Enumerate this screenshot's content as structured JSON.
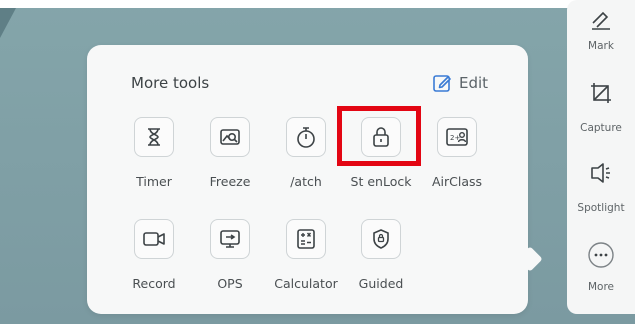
{
  "popup": {
    "title": "More tools",
    "edit_label": "Edit",
    "tools": [
      {
        "label": "Timer",
        "icon": "hourglass-icon"
      },
      {
        "label": "Freeze",
        "icon": "freeze-icon"
      },
      {
        "label": "/atch",
        "icon": "stopwatch-icon"
      },
      {
        "label": "St enLock",
        "icon": "lock-icon"
      },
      {
        "label": "AirClass",
        "icon": "airclass-icon"
      },
      {
        "label": "Record",
        "icon": "video-camera-icon"
      },
      {
        "label": "OPS",
        "icon": "monitor-icon"
      },
      {
        "label": "Calculator",
        "icon": "calculator-icon"
      },
      {
        "label": "Guided",
        "icon": "shield-icon"
      }
    ]
  },
  "sidebar": {
    "items": [
      {
        "label": "Mark",
        "icon": "pen-icon"
      },
      {
        "label": "Capture",
        "icon": "crop-icon"
      },
      {
        "label": "Spotlight",
        "icon": "spotlight-icon"
      },
      {
        "label": "More",
        "icon": "more-dots-icon"
      }
    ]
  },
  "colors": {
    "highlight": "#e30613",
    "edit_accent": "#3a7bd5",
    "background": "#84a5aa",
    "panel": "#f7f8f8"
  }
}
